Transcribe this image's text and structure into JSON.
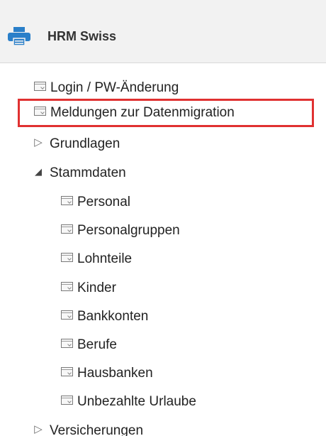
{
  "header": {
    "title": "HRM Swiss",
    "icon": "printer-icon",
    "accent_color": "#2a7fc9"
  },
  "tree": {
    "items": [
      {
        "label": "Login / PW-Änderung",
        "icon": "page-icon"
      },
      {
        "label": "Meldungen zur Datenmigration",
        "icon": "page-icon",
        "highlighted": true,
        "highlight_color": "#e03131"
      },
      {
        "label": "Grundlagen",
        "icon": "collapsed-arrow-icon",
        "expanded": false
      },
      {
        "label": "Stammdaten",
        "icon": "expanded-arrow-icon",
        "expanded": true,
        "children": [
          {
            "label": "Personal",
            "icon": "page-icon"
          },
          {
            "label": "Personalgruppen",
            "icon": "page-icon"
          },
          {
            "label": "Lohnteile",
            "icon": "page-icon"
          },
          {
            "label": "Kinder",
            "icon": "page-icon"
          },
          {
            "label": "Bankkonten",
            "icon": "page-icon"
          },
          {
            "label": "Berufe",
            "icon": "page-icon"
          },
          {
            "label": "Hausbanken",
            "icon": "page-icon"
          },
          {
            "label": "Unbezahlte Urlaube",
            "icon": "page-icon"
          }
        ]
      },
      {
        "label": "Versicherungen",
        "icon": "collapsed-arrow-icon",
        "expanded": false
      }
    ]
  }
}
